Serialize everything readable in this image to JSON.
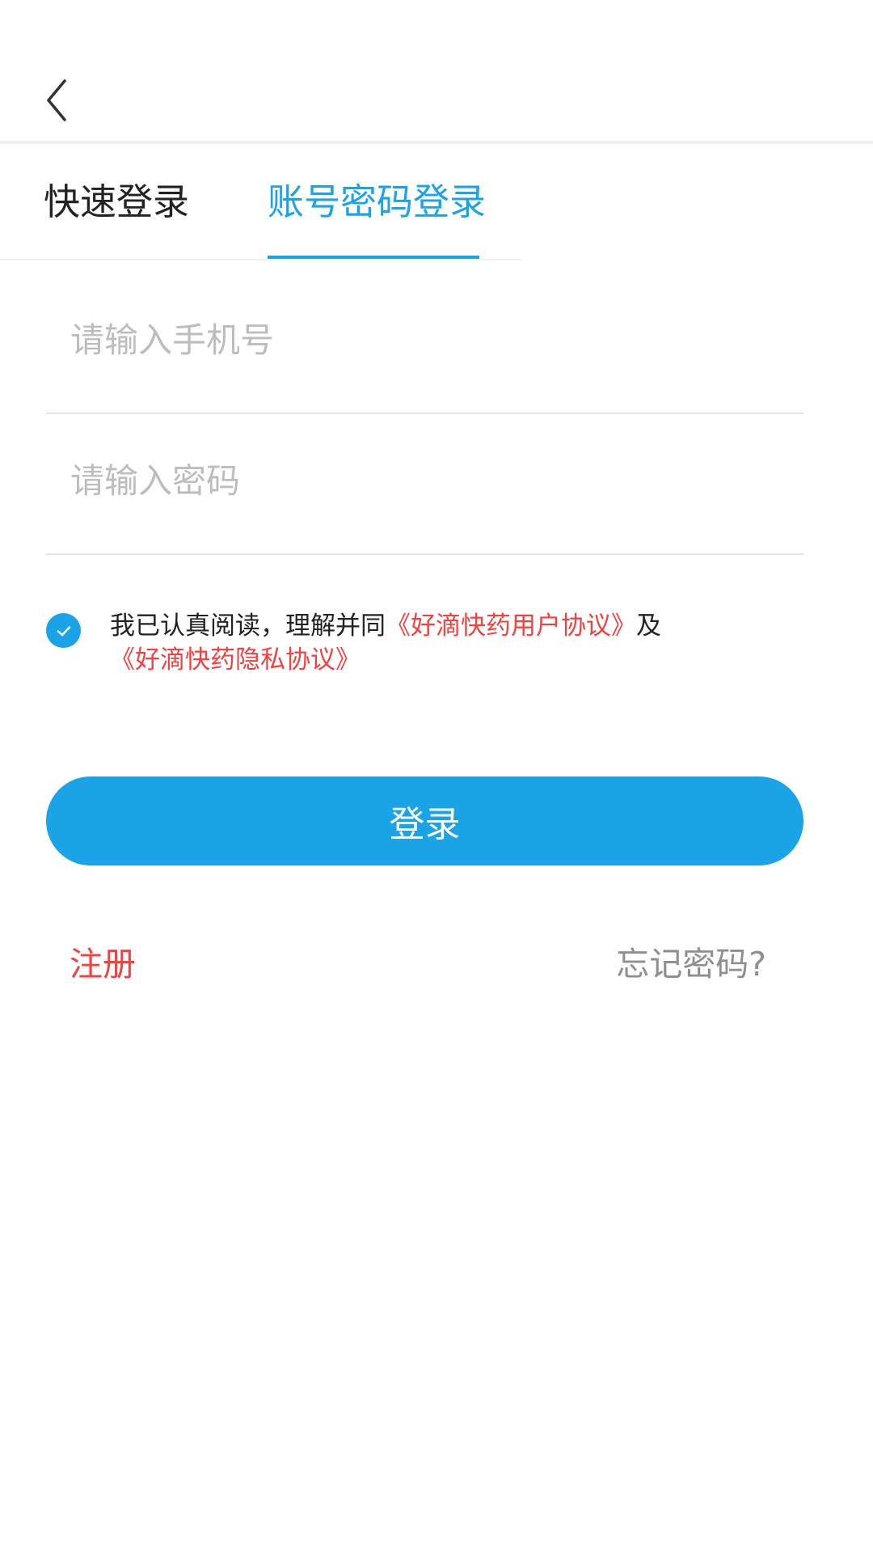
{
  "header": {
    "back_icon": "chevron-left-icon"
  },
  "tabs": [
    {
      "label": "快速登录",
      "active": false
    },
    {
      "label": "账号密码登录",
      "active": true
    }
  ],
  "form": {
    "phone_placeholder": "请输入手机号",
    "phone_value": "",
    "password_placeholder": "请输入密码",
    "password_value": ""
  },
  "agreement": {
    "checked": true,
    "text_prefix": "我已认真阅读，理解并同",
    "link_user_agreement": "《好滴快药用户协议》",
    "text_and": "及",
    "link_privacy": "《好滴快药隐私协议》"
  },
  "actions": {
    "login_label": "登录",
    "register_label": "注册",
    "forgot_label": "忘记密码?"
  },
  "colors": {
    "accent": "#1AA3E6",
    "link": "#F2413F",
    "muted": "#8F8F8F"
  }
}
